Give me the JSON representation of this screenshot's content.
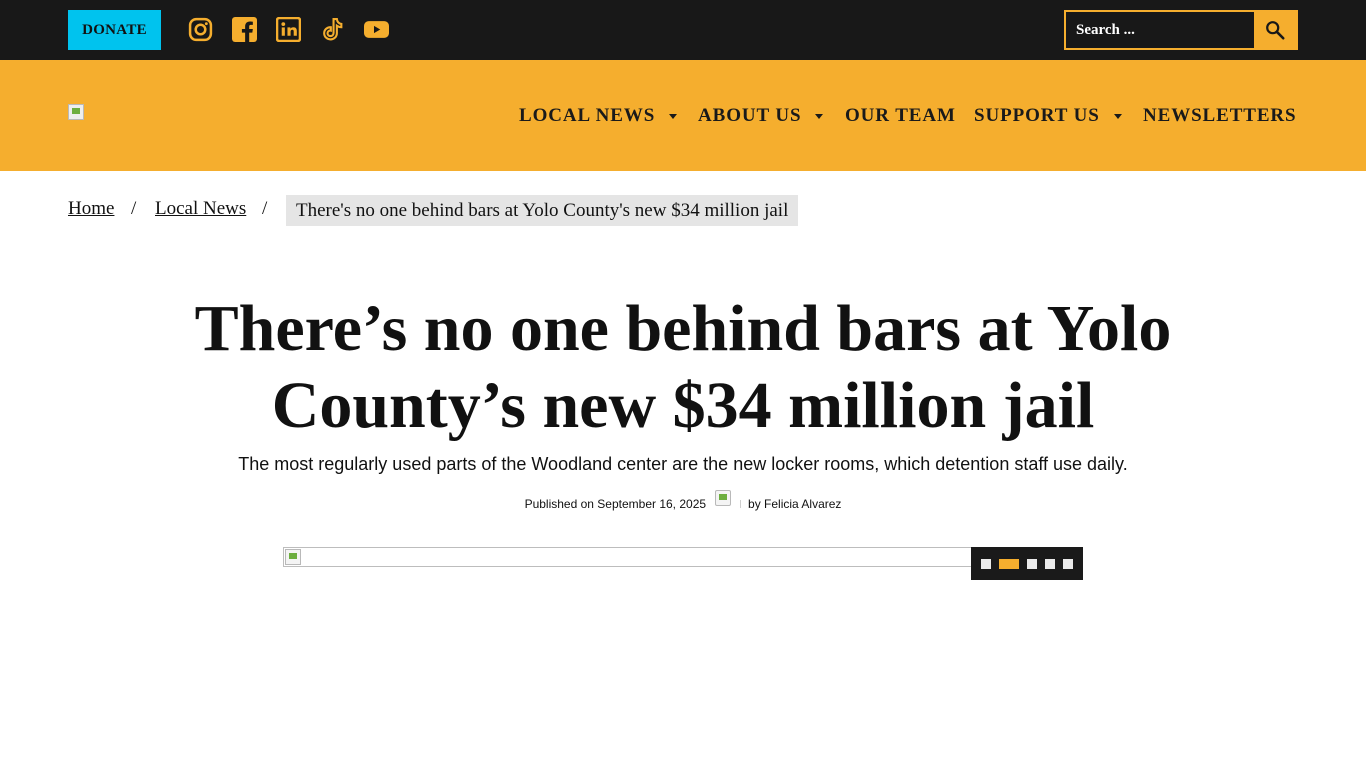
{
  "topbar": {
    "donate_label": "DONATE",
    "social": [
      "instagram-icon",
      "facebook-icon",
      "linkedin-icon",
      "tiktok-icon",
      "youtube-icon"
    ],
    "search_placeholder": "Search ...",
    "search_icon": "magnifier-icon"
  },
  "colors": {
    "topbar_bg": "#181818",
    "accent": "#f5ae2e",
    "donate_bg": "#00c3ee",
    "breadcrumb_current_bg": "#e5e5e5"
  },
  "nav": {
    "items": [
      {
        "label": "LOCAL NEWS",
        "has_dropdown": true
      },
      {
        "label": "ABOUT US",
        "has_dropdown": true
      },
      {
        "label": "OUR TEAM",
        "has_dropdown": false
      },
      {
        "label": "SUPPORT US",
        "has_dropdown": true
      },
      {
        "label": "NEWSLETTERS",
        "has_dropdown": false
      }
    ]
  },
  "breadcrumb": {
    "home": "Home",
    "section": "Local News",
    "separator": "/",
    "current": "There's no one behind bars at Yolo County's new $34 million jail"
  },
  "article": {
    "title": "There’s no one behind bars at Yolo County’s new $34 million jail",
    "subtitle": "The most regularly used parts of the Woodland center are the new locker rooms, which detention staff use daily.",
    "published": "Published on September 16, 2025",
    "byline": "by Felicia Alvarez"
  },
  "slider": {
    "slide_count": 5,
    "active_index": 1
  }
}
